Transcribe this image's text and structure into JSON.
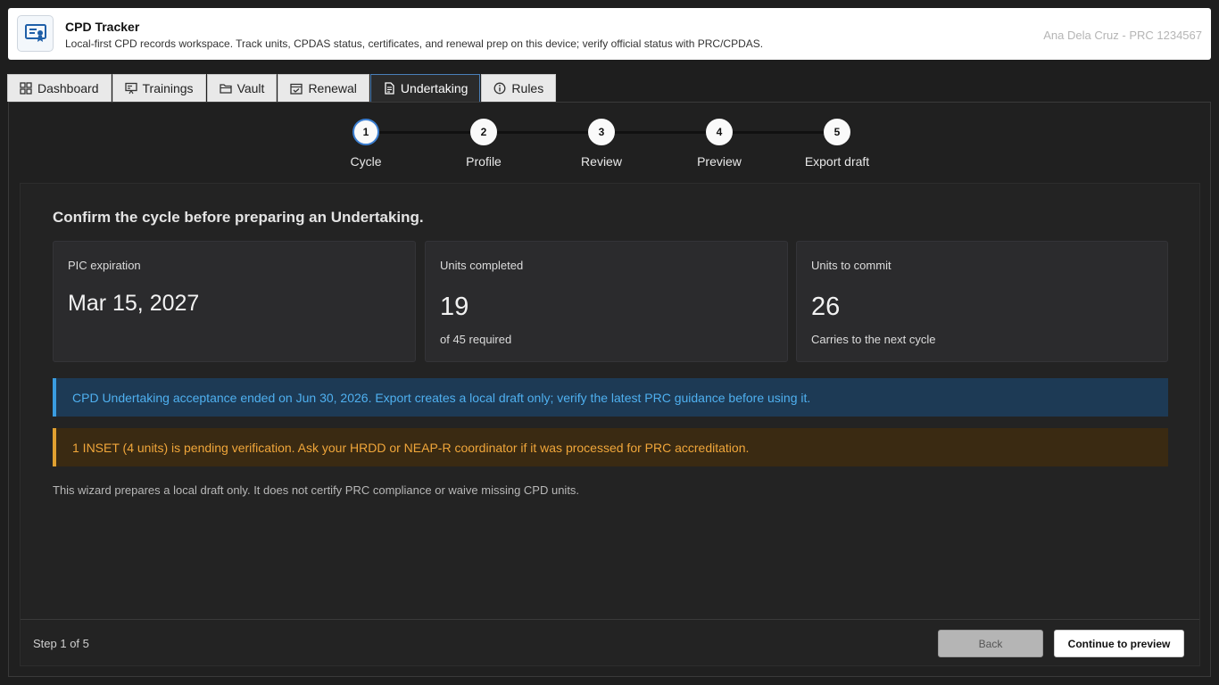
{
  "app": {
    "title": "CPD Tracker",
    "subtitle": "Local-first CPD records workspace. Track units, CPDAS status, certificates, and renewal prep on this device; verify official status with PRC/CPDAS.",
    "user": "Ana Dela Cruz - PRC 1234567",
    "logo_icon": "certificate-icon"
  },
  "tabs": [
    {
      "label": "Dashboard",
      "icon": "grid-icon",
      "active": false
    },
    {
      "label": "Trainings",
      "icon": "presentation-icon",
      "active": false
    },
    {
      "label": "Vault",
      "icon": "folder-icon",
      "active": false
    },
    {
      "label": "Renewal",
      "icon": "calendar-check-icon",
      "active": false
    },
    {
      "label": "Undertaking",
      "icon": "document-icon",
      "active": true
    },
    {
      "label": "Rules",
      "icon": "info-icon",
      "active": false
    }
  ],
  "stepper": {
    "current": 1,
    "steps": [
      {
        "number": "1",
        "label": "Cycle"
      },
      {
        "number": "2",
        "label": "Profile"
      },
      {
        "number": "3",
        "label": "Review"
      },
      {
        "number": "4",
        "label": "Preview"
      },
      {
        "number": "5",
        "label": "Export draft"
      }
    ]
  },
  "main": {
    "heading": "Confirm the cycle before preparing an Undertaking.",
    "cards": [
      {
        "label": "PIC expiration",
        "value": "Mar 15, 2027",
        "sub": ""
      },
      {
        "label": "Units completed",
        "value": "19",
        "sub": "of 45 required"
      },
      {
        "label": "Units to commit",
        "value": "26",
        "sub": "Carries to the next cycle"
      }
    ],
    "info_banner": "CPD Undertaking acceptance ended on Jun 30, 2026. Export creates a local draft only; verify the latest PRC guidance before using it.",
    "warning_banner": "1 INSET (4 units) is pending verification. Ask your HRDD or NEAP-R coordinator if it was processed for PRC accreditation.",
    "note": "This wizard prepares a local draft only. It does not certify PRC compliance or waive missing CPD units."
  },
  "footer": {
    "step_count": "Step 1 of 5",
    "back_label": "Back",
    "continue_label": "Continue to preview"
  },
  "colors": {
    "accent": "#3b7ed0",
    "info": "#4fb0f0",
    "warning": "#f0a63a"
  }
}
